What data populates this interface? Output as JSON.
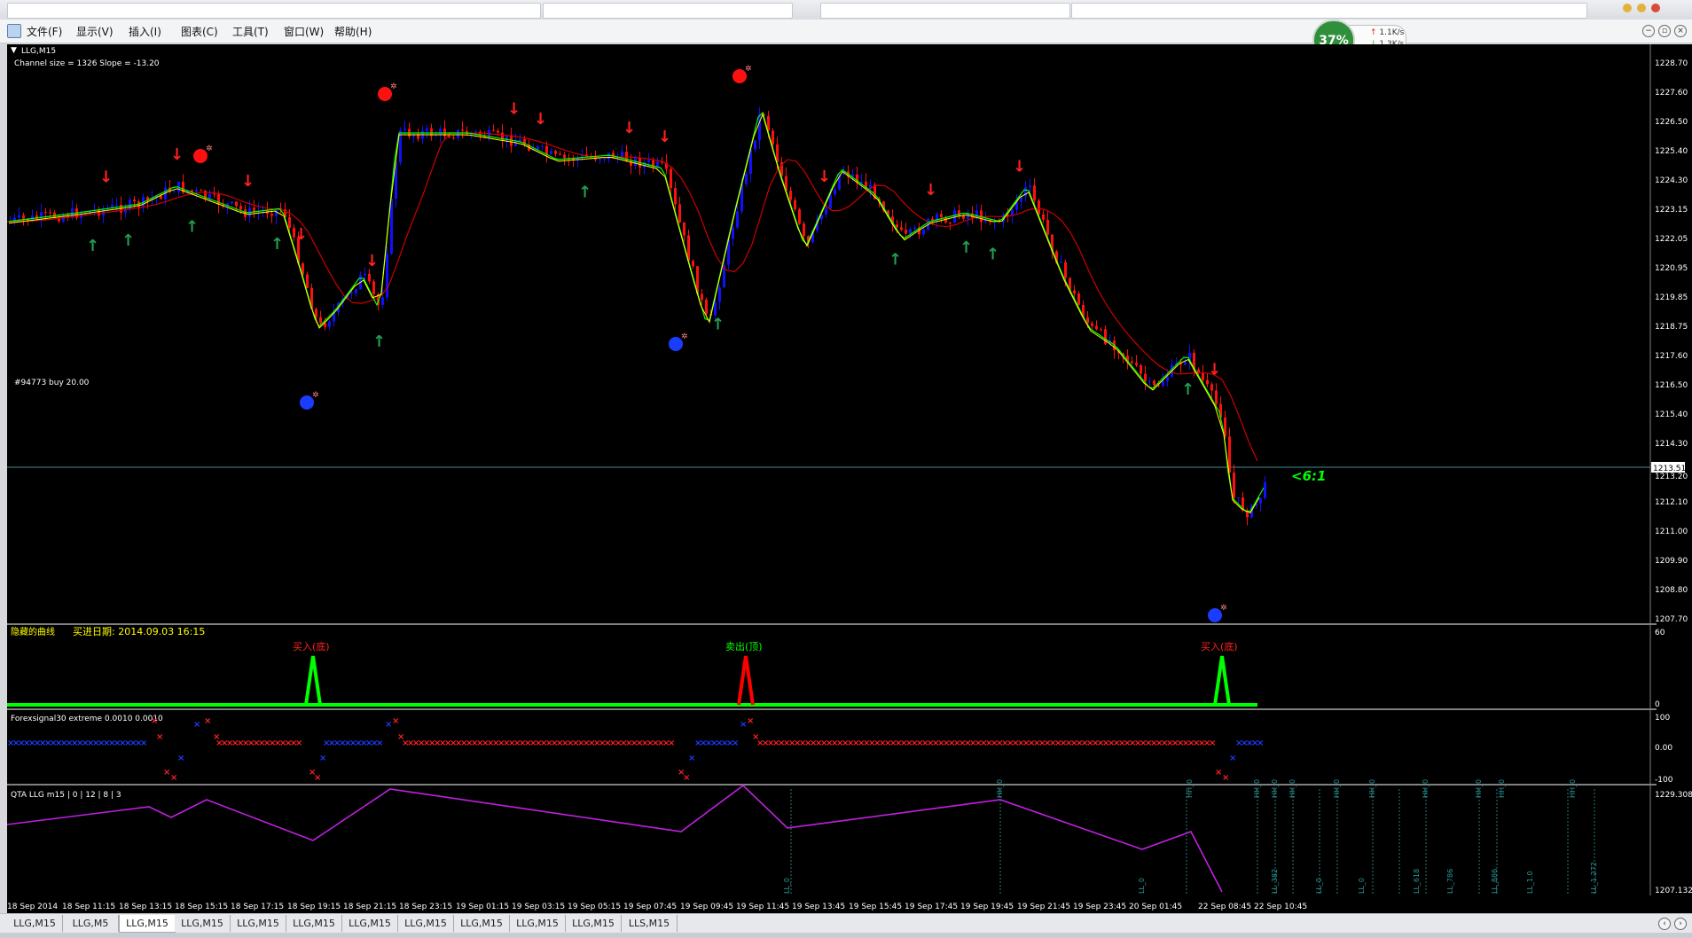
{
  "menu": {
    "items": [
      "文件(F)",
      "显示(V)",
      "插入(I)",
      "图表(C)",
      "工具(T)",
      "窗口(W)",
      "帮助(H)"
    ]
  },
  "network": {
    "cpu": "37%",
    "up": "1.1K/s",
    "down": "1.3K/s"
  },
  "main_chart": {
    "symbol_label": "LLG,M15",
    "channel_label": "Channel size = 1326 Slope = -13.20",
    "order_label": "#94773 buy 20.00",
    "ratio_label": "<6:1",
    "current_price": "1213.51",
    "y_ticks": [
      "1228.70",
      "1227.60",
      "1226.50",
      "1225.40",
      "1224.30",
      "1223.15",
      "1222.05",
      "1220.95",
      "1219.85",
      "1218.75",
      "1217.60",
      "1216.50",
      "1215.40",
      "1214.30",
      "1213.20",
      "1212.10",
      "1211.00",
      "1209.90",
      "1208.80",
      "1207.70"
    ],
    "colors": {
      "up": "#0000ff",
      "down": "#ff0000",
      "ma_fast": "#00ff00",
      "ma_fast2": "#ffff00",
      "ma_slow": "#cc0000",
      "bg": "#000000"
    }
  },
  "panel1": {
    "title": "隐藏的曲线",
    "date_label": "买进日期: 2014.09.03 16:15",
    "y_ticks": [
      "60",
      "0"
    ],
    "signals": [
      {
        "label": "买入(底)",
        "color": "#00ff00",
        "x": 0.16
      },
      {
        "label": "卖出(顶)",
        "color": "#ff0000",
        "x": 0.43
      },
      {
        "label": "买入(底)",
        "color": "#00ff00",
        "x": 0.73
      }
    ]
  },
  "panel2": {
    "title": "Forexsignal30 extreme 0.0010 0.0010",
    "y_ticks": [
      "100",
      "0.00",
      "-100"
    ]
  },
  "panel3": {
    "title": "QTA LLG m15 | 0 | 12 | 8 | 3",
    "y_ticks": [
      "1229.308",
      "1207.132"
    ],
    "markers_top": [
      "HH_0",
      "HH_0",
      "HH_0",
      "HH_0",
      "HH_0",
      "HH_0",
      "HH_0",
      "HH_0",
      "HH_0",
      "HH_0",
      "HH_0"
    ],
    "markers_bottom": [
      "LL_0",
      "LL_0",
      "LL_382",
      "LL_0",
      "LL_0",
      "LL_618",
      "LL_786",
      "LL_886",
      "LL_1.0",
      "LL_1.272"
    ]
  },
  "x_axis": {
    "labels": [
      "18 Sep 2014",
      "18 Sep 11:15",
      "18 Sep 13:15",
      "18 Sep 15:15",
      "18 Sep 17:15",
      "18 Sep 19:15",
      "18 Sep 21:15",
      "18 Sep 23:15",
      "19 Sep 01:15",
      "19 Sep 03:15",
      "19 Sep 05:15",
      "19 Sep 07:45",
      "19 Sep 09:45",
      "19 Sep 11:45",
      "19 Sep 13:45",
      "19 Sep 15:45",
      "19 Sep 17:45",
      "19 Sep 19:45",
      "19 Sep 21:45",
      "19 Sep 23:45",
      "20 Sep 01:45",
      "22 Sep 08:45",
      "22 Sep 10:45"
    ]
  },
  "bottom_tabs": [
    "LLG,M15",
    "LLG,M5",
    "LLG,M15",
    "LLG,M15",
    "LLG,M15",
    "LLG,M15",
    "LLG,M15",
    "LLG,M15",
    "LLG,M15",
    "LLG,M15",
    "LLG,M15",
    "LLS,M15"
  ],
  "active_tab_index": 2
}
